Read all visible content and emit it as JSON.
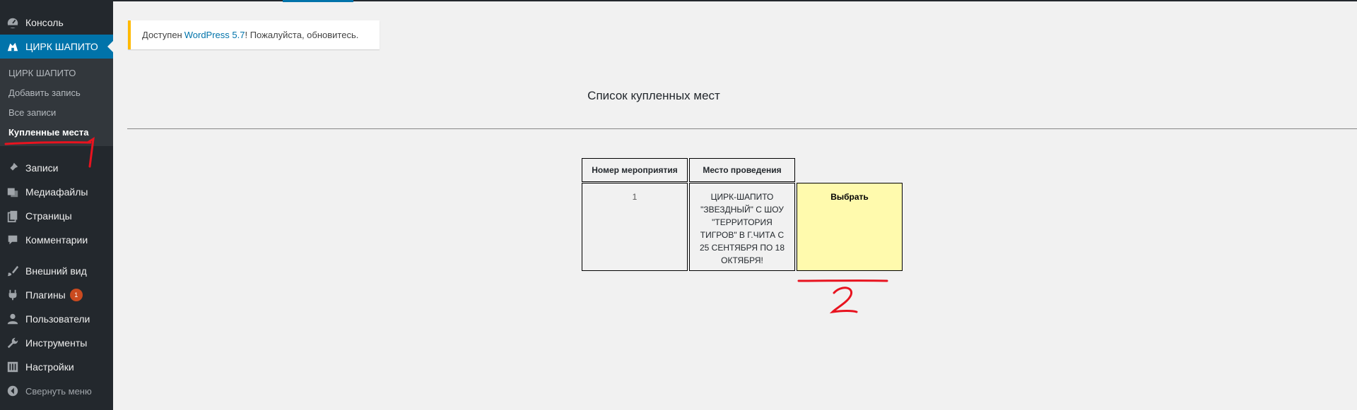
{
  "sidebar": {
    "items_top": [
      {
        "label": "Консоль",
        "icon": "dashboard-icon"
      }
    ],
    "current": {
      "label": "ЦИРК ШАПИТО",
      "icon": "tent-icon"
    },
    "submenu": [
      {
        "label": "ЦИРК ШАПИТО"
      },
      {
        "label": "Добавить запись"
      },
      {
        "label": "Все записи"
      },
      {
        "label": "Купленные места"
      }
    ],
    "items": [
      {
        "label": "Записи",
        "icon": "pin-icon"
      },
      {
        "label": "Медиафайлы",
        "icon": "media-icon"
      },
      {
        "label": "Страницы",
        "icon": "pages-icon"
      },
      {
        "label": "Комментарии",
        "icon": "comment-icon"
      },
      {
        "label": "Внешний вид",
        "icon": "brush-icon"
      },
      {
        "label": "Плагины",
        "icon": "plugin-icon",
        "badge": "1"
      },
      {
        "label": "Пользователи",
        "icon": "user-icon"
      },
      {
        "label": "Инструменты",
        "icon": "wrench-icon"
      },
      {
        "label": "Настройки",
        "icon": "settings-icon"
      }
    ],
    "collapse_label": "Свернуть меню"
  },
  "notice": {
    "prefix": "Доступен",
    "link": "WordPress 5.7",
    "suffix": "! Пожалуйста, обновитесь."
  },
  "page": {
    "heading": "Список купленных мест"
  },
  "table": {
    "headers": [
      "Номер мероприятия",
      "Место проведения"
    ],
    "rows": [
      {
        "number": "1",
        "place": "ЦИРК-ШАПИТО \"ЗВЕЗДНЫЙ\" С ШОУ \"ТЕРРИТОРИЯ ТИГРОВ\" В Г.ЧИТА С 25 СЕНТЯБРЯ ПО 18 ОКТЯБРЯ!",
        "action": "Выбрать"
      }
    ]
  },
  "annotations": {
    "marker1": "1",
    "marker2": "2",
    "color": "#e8131f"
  },
  "colors": {
    "sidebar_bg": "#23282d",
    "accent": "#0073aa",
    "notice_border": "#ffb900",
    "action_bg": "#fffaad"
  }
}
